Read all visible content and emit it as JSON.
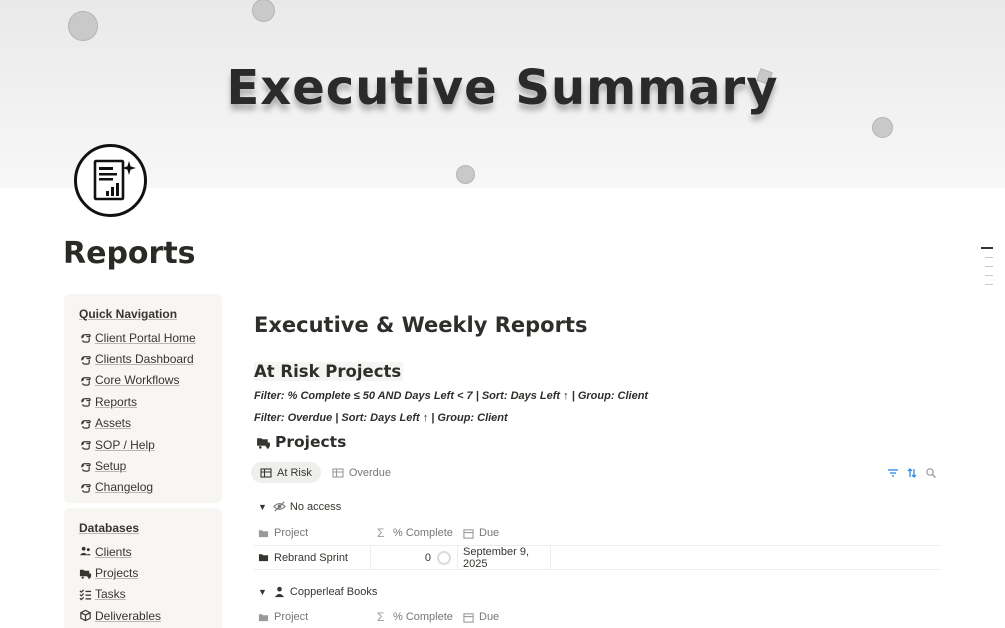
{
  "cover": {
    "title": "Executive Summary"
  },
  "page": {
    "title": "Reports",
    "icon": "report-chart-icon"
  },
  "sidebar": {
    "quick_nav": {
      "heading": "Quick Navigation",
      "items": [
        {
          "label": "Client Portal Home",
          "icon": "hand-pointer-icon"
        },
        {
          "label": "Clients Dashboard",
          "icon": "hand-pointer-icon"
        },
        {
          "label": "Core Workflows",
          "icon": "hand-pointer-icon"
        },
        {
          "label": "Reports",
          "icon": "hand-pointer-icon"
        },
        {
          "label": "Assets",
          "icon": "hand-pointer-icon"
        },
        {
          "label": "SOP / Help",
          "icon": "hand-pointer-icon"
        },
        {
          "label": "Setup",
          "icon": "hand-pointer-icon"
        },
        {
          "label": "Changelog",
          "icon": "hand-pointer-icon"
        }
      ]
    },
    "databases": {
      "heading": "Databases",
      "items": [
        {
          "label": "Clients",
          "icon": "people-icon"
        },
        {
          "label": "Projects",
          "icon": "folder-truck-icon"
        },
        {
          "label": "Tasks",
          "icon": "checklist-icon"
        },
        {
          "label": "Deliverables",
          "icon": "package-icon"
        }
      ]
    }
  },
  "main": {
    "heading": "Executive & Weekly Reports",
    "subheading": "At Risk Projects",
    "filter1": "Filter:  % Complete ≤ 50 AND Days Left < 7 | Sort: Days Left ↑ | Group: Client",
    "filter2": "Filter: Overdue | Sort: Days Left ↑ | Group: Client",
    "database": {
      "title": "Projects",
      "tabs": [
        {
          "label": "At Risk",
          "active": true
        },
        {
          "label": "Overdue",
          "active": false
        }
      ],
      "tools": [
        "filter-icon",
        "sort-icon",
        "search-icon"
      ],
      "columns": {
        "project": "Project",
        "percent": "% Complete",
        "due": "Due"
      },
      "groups": [
        {
          "name": "No access",
          "icon": "eye-slash-icon",
          "rows": [
            {
              "project": "Rebrand Sprint",
              "percent": "0",
              "due": "September 9, 2025"
            }
          ]
        },
        {
          "name": "Copperleaf Books",
          "icon": "person-icon",
          "rows": []
        }
      ]
    }
  }
}
